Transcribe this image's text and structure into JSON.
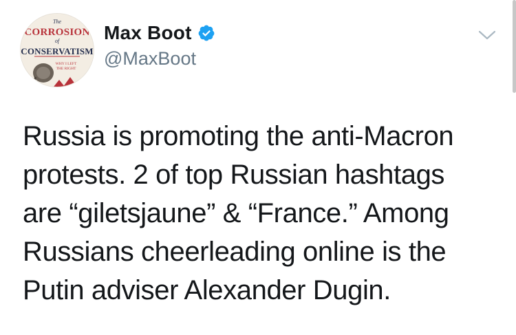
{
  "author": {
    "display_name": "Max Boot",
    "handle": "@MaxBoot",
    "verified": true,
    "avatar": {
      "book_the": "The",
      "book_title_1": "CORROSION",
      "book_of": "of",
      "book_title_2": "CONSERVATISM",
      "book_subtitle_1": "WHY I LEFT",
      "book_subtitle_2": "THE RIGHT"
    }
  },
  "tweet": {
    "lines": [
      "Russia is promoting the anti-Macron",
      "protests. 2 of top Russian hashtags",
      "are “giletsjaune” & “France.” Among",
      "Russians cheerleading online is the",
      "Putin adviser Alexander Dugin."
    ]
  },
  "icons": {
    "more_menu": "chevron-down-icon",
    "verified": "verified-badge-icon"
  },
  "colors": {
    "verified_blue": "#1da1f2",
    "name_text": "#14171a",
    "handle_text": "#657786",
    "book_red": "#b8323a",
    "book_navy": "#26304f"
  }
}
